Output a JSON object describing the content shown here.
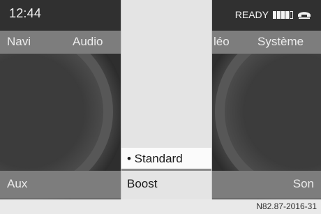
{
  "status": {
    "time": "12:44",
    "ready_label": "READY",
    "signal_icon": "signal-strength-icon",
    "phone_icon": "phone-handset-icon"
  },
  "menu": {
    "items": [
      "Navi",
      "Audio",
      "léo",
      "Système"
    ]
  },
  "popup": {
    "options": [
      {
        "label": "• Standard",
        "selected": true
      },
      {
        "label": "Boost",
        "selected": false
      }
    ]
  },
  "bottom": {
    "left_label": "Aux",
    "right_label": "Son"
  },
  "caption": "N82.87-2016-31",
  "colors": {
    "bar_gray": "#7d7d7d",
    "screen_dark": "#2d2d2d",
    "popup_bg": "#e4e4e4"
  }
}
